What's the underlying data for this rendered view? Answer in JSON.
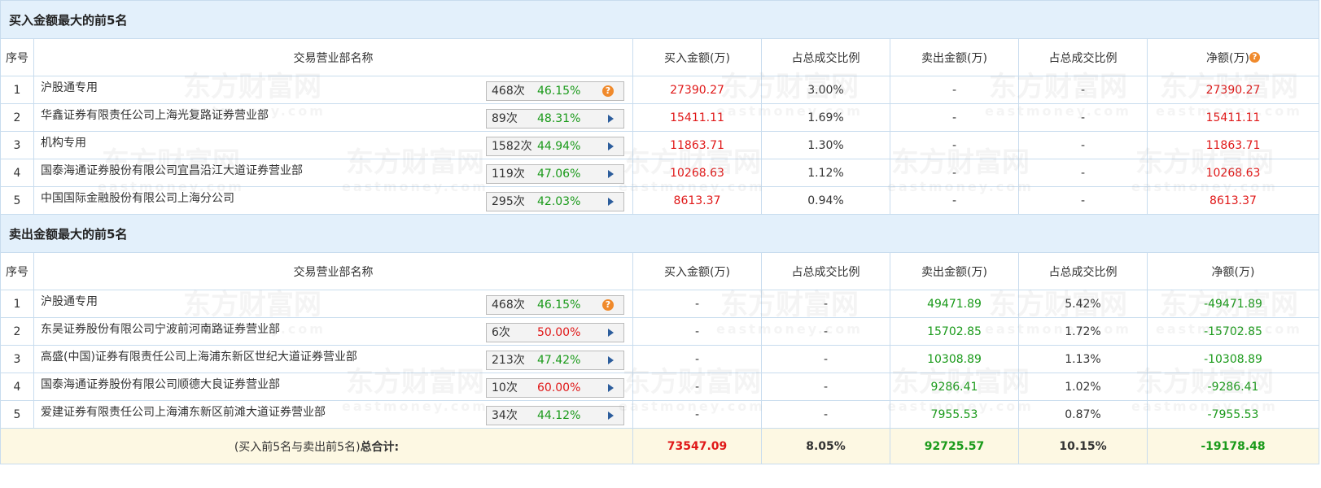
{
  "buy": {
    "title": "买入金额最大的前5名",
    "headers": [
      "序号",
      "交易营业部名称",
      "买入金额(万)",
      "占总成交比例",
      "卖出金额(万)",
      "占总成交比例",
      "净额(万)"
    ],
    "help_icon": "question-circle-icon",
    "rows": [
      {
        "no": "1",
        "name": "沪股通专用",
        "count": "468次",
        "rate": "46.15%",
        "buy": "27390.27",
        "buy_pct": "3.00%",
        "sell": "-",
        "sell_pct": "-",
        "net": "27390.27",
        "icon": "question-circle-icon"
      },
      {
        "no": "2",
        "name": "华鑫证券有限责任公司上海光复路证券营业部",
        "count": "89次",
        "rate": "48.31%",
        "buy": "15411.11",
        "buy_pct": "1.69%",
        "sell": "-",
        "sell_pct": "-",
        "net": "15411.11",
        "icon": "play-arrow-icon"
      },
      {
        "no": "3",
        "name": "机构专用",
        "count": "1582次",
        "rate": "44.94%",
        "buy": "11863.71",
        "buy_pct": "1.30%",
        "sell": "-",
        "sell_pct": "-",
        "net": "11863.71",
        "icon": "play-arrow-icon"
      },
      {
        "no": "4",
        "name": "国泰海通证券股份有限公司宜昌沿江大道证券营业部",
        "count": "119次",
        "rate": "47.06%",
        "buy": "10268.63",
        "buy_pct": "1.12%",
        "sell": "-",
        "sell_pct": "-",
        "net": "10268.63",
        "icon": "play-arrow-icon"
      },
      {
        "no": "5",
        "name": "中国国际金融股份有限公司上海分公司",
        "count": "295次",
        "rate": "42.03%",
        "buy": "8613.37",
        "buy_pct": "0.94%",
        "sell": "-",
        "sell_pct": "-",
        "net": "8613.37",
        "icon": "play-arrow-icon"
      }
    ]
  },
  "sell": {
    "title": "卖出金额最大的前5名",
    "headers": [
      "序号",
      "交易营业部名称",
      "买入金额(万)",
      "占总成交比例",
      "卖出金额(万)",
      "占总成交比例",
      "净额(万)"
    ],
    "rows": [
      {
        "no": "1",
        "name": "沪股通专用",
        "count": "468次",
        "rate": "46.15%",
        "buy": "-",
        "buy_pct": "-",
        "sell": "49471.89",
        "sell_pct": "5.42%",
        "net": "-49471.89",
        "icon": "question-circle-icon"
      },
      {
        "no": "2",
        "name": "东吴证券股份有限公司宁波前河南路证券营业部",
        "count": "6次",
        "rate": "50.00%",
        "buy": "-",
        "buy_pct": "-",
        "sell": "15702.85",
        "sell_pct": "1.72%",
        "net": "-15702.85",
        "icon": "play-arrow-icon"
      },
      {
        "no": "3",
        "name": "高盛(中国)证券有限责任公司上海浦东新区世纪大道证券营业部",
        "count": "213次",
        "rate": "47.42%",
        "buy": "-",
        "buy_pct": "-",
        "sell": "10308.89",
        "sell_pct": "1.13%",
        "net": "-10308.89",
        "icon": "play-arrow-icon"
      },
      {
        "no": "4",
        "name": "国泰海通证券股份有限公司顺德大良证券营业部",
        "count": "10次",
        "rate": "60.00%",
        "buy": "-",
        "buy_pct": "-",
        "sell": "9286.41",
        "sell_pct": "1.02%",
        "net": "-9286.41",
        "icon": "play-arrow-icon"
      },
      {
        "no": "5",
        "name": "爱建证券有限责任公司上海浦东新区前滩大道证券营业部",
        "count": "34次",
        "rate": "44.12%",
        "buy": "-",
        "buy_pct": "-",
        "sell": "7955.53",
        "sell_pct": "0.87%",
        "net": "-7955.53",
        "icon": "play-arrow-icon"
      }
    ]
  },
  "total": {
    "label_prefix": "(买入前5名与卖出前5名)",
    "label_bold": "总合计:",
    "buy": "73547.09",
    "buy_pct": "8.05%",
    "sell": "92725.57",
    "sell_pct": "10.15%",
    "net": "-19178.48"
  },
  "watermark": {
    "cn": "东方财富网",
    "en": "eastmoney.com"
  },
  "colors": {
    "header_bg": "#e3f0fb",
    "border": "#c8dcee",
    "total_bg": "#fdf8e3",
    "red": "#e01818",
    "green": "#1a9a1a",
    "help_orange": "#f08a2c",
    "arrow_blue": "#2c5d9c"
  }
}
